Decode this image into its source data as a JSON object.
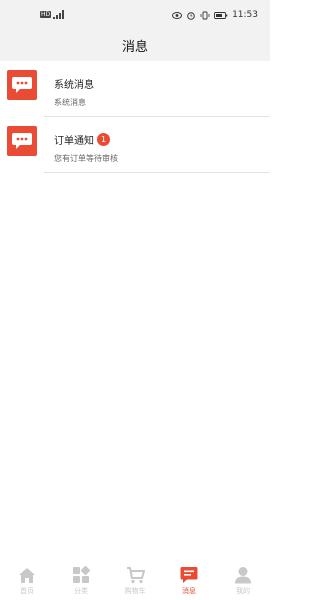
{
  "status_bar": {
    "hd_label": "HD",
    "time": "11:53"
  },
  "header": {
    "title": "消息"
  },
  "messages": [
    {
      "title": "系统消息",
      "subtitle": "系统消息",
      "icon": "chat-bubble-icon"
    },
    {
      "title": "订单通知",
      "subtitle": "您有订单等待审核",
      "badge": "1",
      "icon": "chat-bubble-icon"
    }
  ],
  "tabs": [
    {
      "label": "首页",
      "icon": "home-icon",
      "active": false
    },
    {
      "label": "分类",
      "icon": "category-icon",
      "active": false
    },
    {
      "label": "购物车",
      "icon": "cart-icon",
      "active": false
    },
    {
      "label": "消息",
      "icon": "message-icon",
      "active": true
    },
    {
      "label": "我的",
      "icon": "profile-icon",
      "active": false
    }
  ],
  "colors": {
    "accent": "#e94b35",
    "inactive_tab": "#c8c8c8",
    "header_bg": "#f2f2f2"
  }
}
